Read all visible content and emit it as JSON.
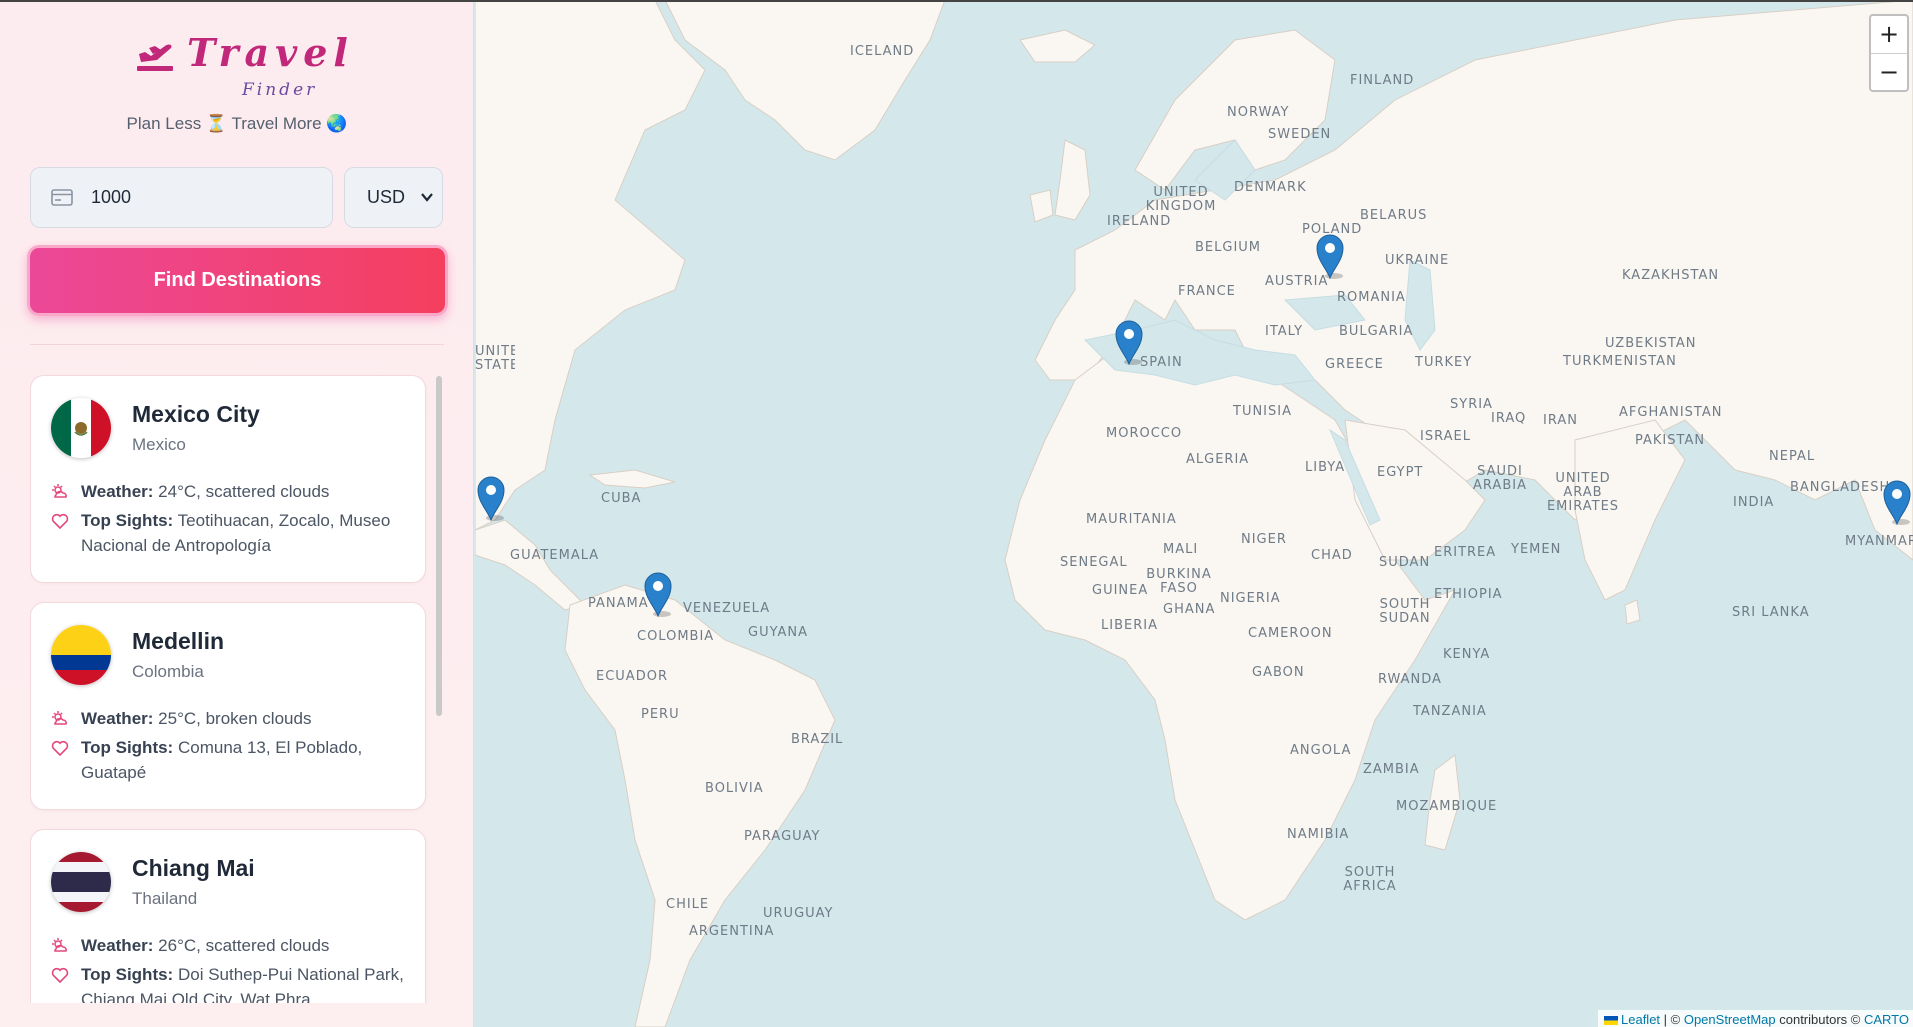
{
  "app": {
    "logo_title": "Travel",
    "logo_subtitle": "Finder",
    "tagline": "Plan Less ⏳ Travel More 🌏"
  },
  "search": {
    "amount_value": "1000",
    "currency_value": "USD",
    "button_label": "Find Destinations"
  },
  "destinations": [
    {
      "city": "Mexico City",
      "country": "Mexico",
      "weather_label": "Weather:",
      "weather": "24°C, scattered clouds",
      "sights_label": "Top Sights:",
      "sights": "Teotihuacan, Zocalo, Museo Nacional de Antropología"
    },
    {
      "city": "Medellin",
      "country": "Colombia",
      "weather_label": "Weather:",
      "weather": "25°C, broken clouds",
      "sights_label": "Top Sights:",
      "sights": "Comuna 13, El Poblado, Guatapé"
    },
    {
      "city": "Chiang Mai",
      "country": "Thailand",
      "weather_label": "Weather:",
      "weather": "26°C, scattered clouds",
      "sights_label": "Top Sights:",
      "sights": "Doi Suthep-Pui National Park, Chiang Mai Old City, Wat Phra"
    }
  ],
  "map": {
    "zoom_in": "+",
    "zoom_out": "−",
    "attribution": {
      "leaflet": "Leaflet",
      "sep1": " | © ",
      "osm": "OpenStreetMap",
      "contributors": " contributors © ",
      "carto": "CARTO"
    },
    "labels": [
      "ICELAND",
      "FINLAND",
      "NORWAY",
      "SWEDEN",
      "DENMARK",
      "UNITED KINGDOM",
      "IRELAND",
      "BELARUS",
      "POLAND",
      "BELGIUM",
      "UKRAINE",
      "FRANCE",
      "AUSTRIA",
      "ROMANIA",
      "KAZAKHSTAN",
      "ITALY",
      "BULGARIA",
      "SPAIN",
      "GREECE",
      "TURKEY",
      "UZBEKISTAN",
      "TURKMENISTAN",
      "UNITED STATES",
      "TUNISIA",
      "SYRIA",
      "IRAQ",
      "IRAN",
      "AFGHANISTAN",
      "MOROCCO",
      "ISRAEL",
      "PAKISTAN",
      "ALGERIA",
      "LIBYA",
      "EGYPT",
      "SAUDI ARABIA",
      "UNITED ARAB EMIRATES",
      "NEPAL",
      "BANGLADESH",
      "CUBA",
      "INDIA",
      "MYANMAR",
      "MAURITANIA",
      "MALI",
      "NIGER",
      "CHAD",
      "SUDAN",
      "ERITREA",
      "YEMEN",
      "GUATEMALA",
      "SENEGAL",
      "BURKINA FASO",
      "GUINEA",
      "GHANA",
      "NIGERIA",
      "ETHIOPIA",
      "SOUTH SUDAN",
      "PANAMA",
      "VENEZUELA",
      "GUYANA",
      "LIBERIA",
      "COLOMBIA",
      "CAMEROON",
      "SRI LANKA",
      "ECUADOR",
      "KENYA",
      "GABON",
      "RWANDA",
      "PERU",
      "TANZANIA",
      "BRAZIL",
      "ANGOLA",
      "ZAMBIA",
      "BOLIVIA",
      "MOZAMBIQUE",
      "PARAGUAY",
      "NAMIBIA",
      "SOUTH AFRICA",
      "CHILE",
      "URUGUAY",
      "ARGENTINA"
    ],
    "markers": [
      "mexico-city",
      "medellin",
      "lisbon",
      "krakow",
      "chiang-mai"
    ]
  },
  "colors": {
    "accent_start": "#ec4899",
    "accent_end": "#f43f5e",
    "marker": "#2a81cb",
    "land": "#faf7f2",
    "water": "#d4e8ec"
  }
}
